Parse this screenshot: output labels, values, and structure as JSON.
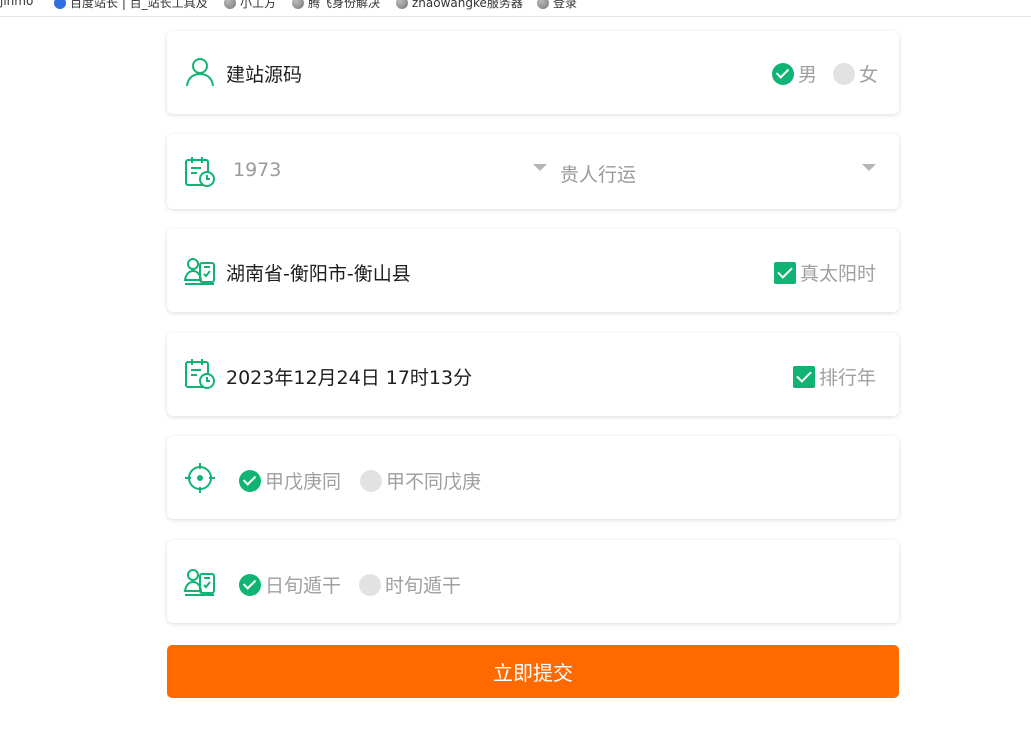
{
  "bookmarks": [
    {
      "label": "jinmo",
      "icon": "globe-icon"
    },
    {
      "label": "百度站长 | 百_站长工具及",
      "icon": "baidu-paw-icon"
    },
    {
      "label": "小工方",
      "icon": "globe-icon"
    },
    {
      "label": "腾飞身份解决",
      "icon": "globe-icon"
    },
    {
      "label": "zhaowangke服务器",
      "icon": "globe-icon"
    },
    {
      "label": "登录",
      "icon": "globe-icon"
    }
  ],
  "form": {
    "name": {
      "value": "建站源码",
      "icon": "user-icon"
    },
    "gender": {
      "options": [
        {
          "label": "男",
          "selected": true
        },
        {
          "label": "女",
          "selected": false
        }
      ]
    },
    "year_row": {
      "icon": "calendar-clock-icon",
      "year": "1973",
      "mode": "贵人行运"
    },
    "location": {
      "value": "湖南省-衡阳市-衡山县",
      "icon": "id-card-icon",
      "checkbox_label": "真太阳时",
      "checked": true
    },
    "datetime": {
      "value": "2023年12月24日 17时13分",
      "icon": "calendar-clock-icon",
      "checkbox_label": "排行年",
      "checked": true
    },
    "rule1": {
      "icon": "target-icon",
      "options": [
        {
          "label": "甲戊庚同",
          "selected": true
        },
        {
          "label": "甲不同戊庚",
          "selected": false
        }
      ]
    },
    "rule2": {
      "icon": "id-card-icon",
      "options": [
        {
          "label": "日旬遁干",
          "selected": true
        },
        {
          "label": "时旬遁干",
          "selected": false
        }
      ]
    },
    "submit_label": "立即提交"
  },
  "colors": {
    "accent": "#0fb374",
    "submit": "#ff6a00",
    "muted": "#9a9a9a"
  }
}
